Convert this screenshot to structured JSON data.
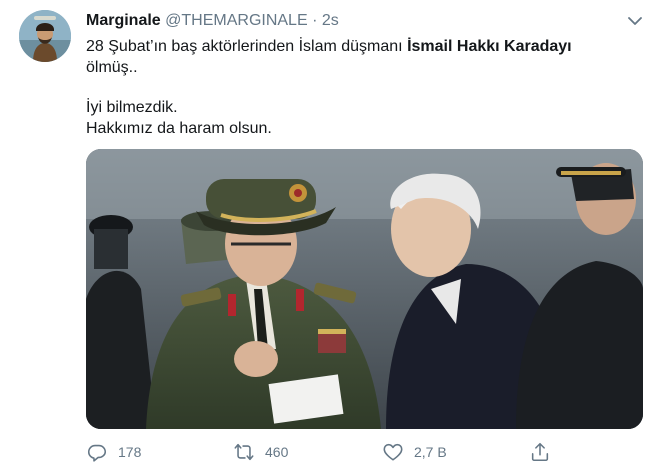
{
  "tweet": {
    "display_name": "Marginale",
    "handle": "@THEMARGINALE",
    "separator": "·",
    "time": "2s",
    "text": {
      "line1_prefix": "28 Şubat’ın baş aktörlerinden İslam düşmanı ",
      "line1_bold": "İsmail Hakkı Karadayı",
      "line2": "ölmüş..",
      "line3": "İyi bilmezdik.",
      "line4": "Hakkımız da haram olsun."
    }
  },
  "actions": {
    "reply_count": "178",
    "retweet_count": "460",
    "like_count": "2,7 B"
  },
  "icons": {
    "caret": "chevron-down-icon",
    "reply": "reply-icon",
    "retweet": "retweet-icon",
    "like": "heart-icon",
    "share": "share-icon"
  },
  "colors": {
    "text": "#14171a",
    "secondary": "#657786"
  }
}
